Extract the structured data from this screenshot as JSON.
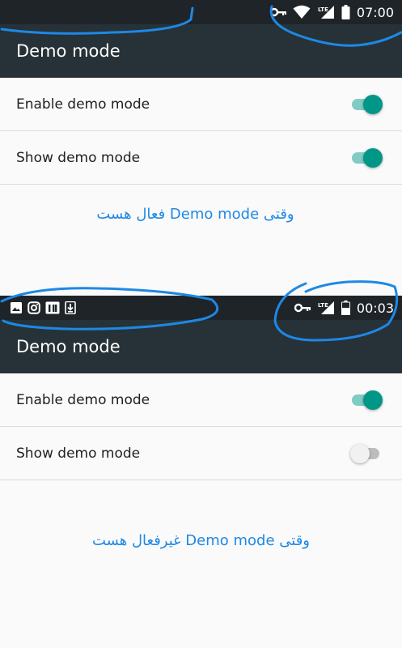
{
  "top": {
    "status": {
      "time": "07:00",
      "lte": "LTE"
    },
    "toolbar": {
      "title": "Demo mode"
    },
    "rows": [
      {
        "label": "Enable demo mode",
        "on": true
      },
      {
        "label": "Show demo mode",
        "on": true
      }
    ],
    "caption": "وقتی Demo mode فعال هست"
  },
  "bottom": {
    "status": {
      "time": "00:03",
      "lte": "LTE"
    },
    "toolbar": {
      "title": "Demo mode"
    },
    "rows": [
      {
        "label": "Enable demo mode",
        "on": true
      },
      {
        "label": "Show demo mode",
        "on": false
      }
    ],
    "caption": "وقتی Demo mode غیرفعال هست"
  },
  "colors": {
    "accent": "#009688",
    "accent_track": "#80cbc4",
    "toolbar": "#263238",
    "statusbar": "#1f2428",
    "caption": "#1e88e5",
    "scribble": "#1e88e5"
  },
  "icons": [
    "key-icon",
    "wifi-icon",
    "signal-icon",
    "battery-icon",
    "image-icon",
    "instagram-icon",
    "calendar-icon",
    "download-icon"
  ]
}
